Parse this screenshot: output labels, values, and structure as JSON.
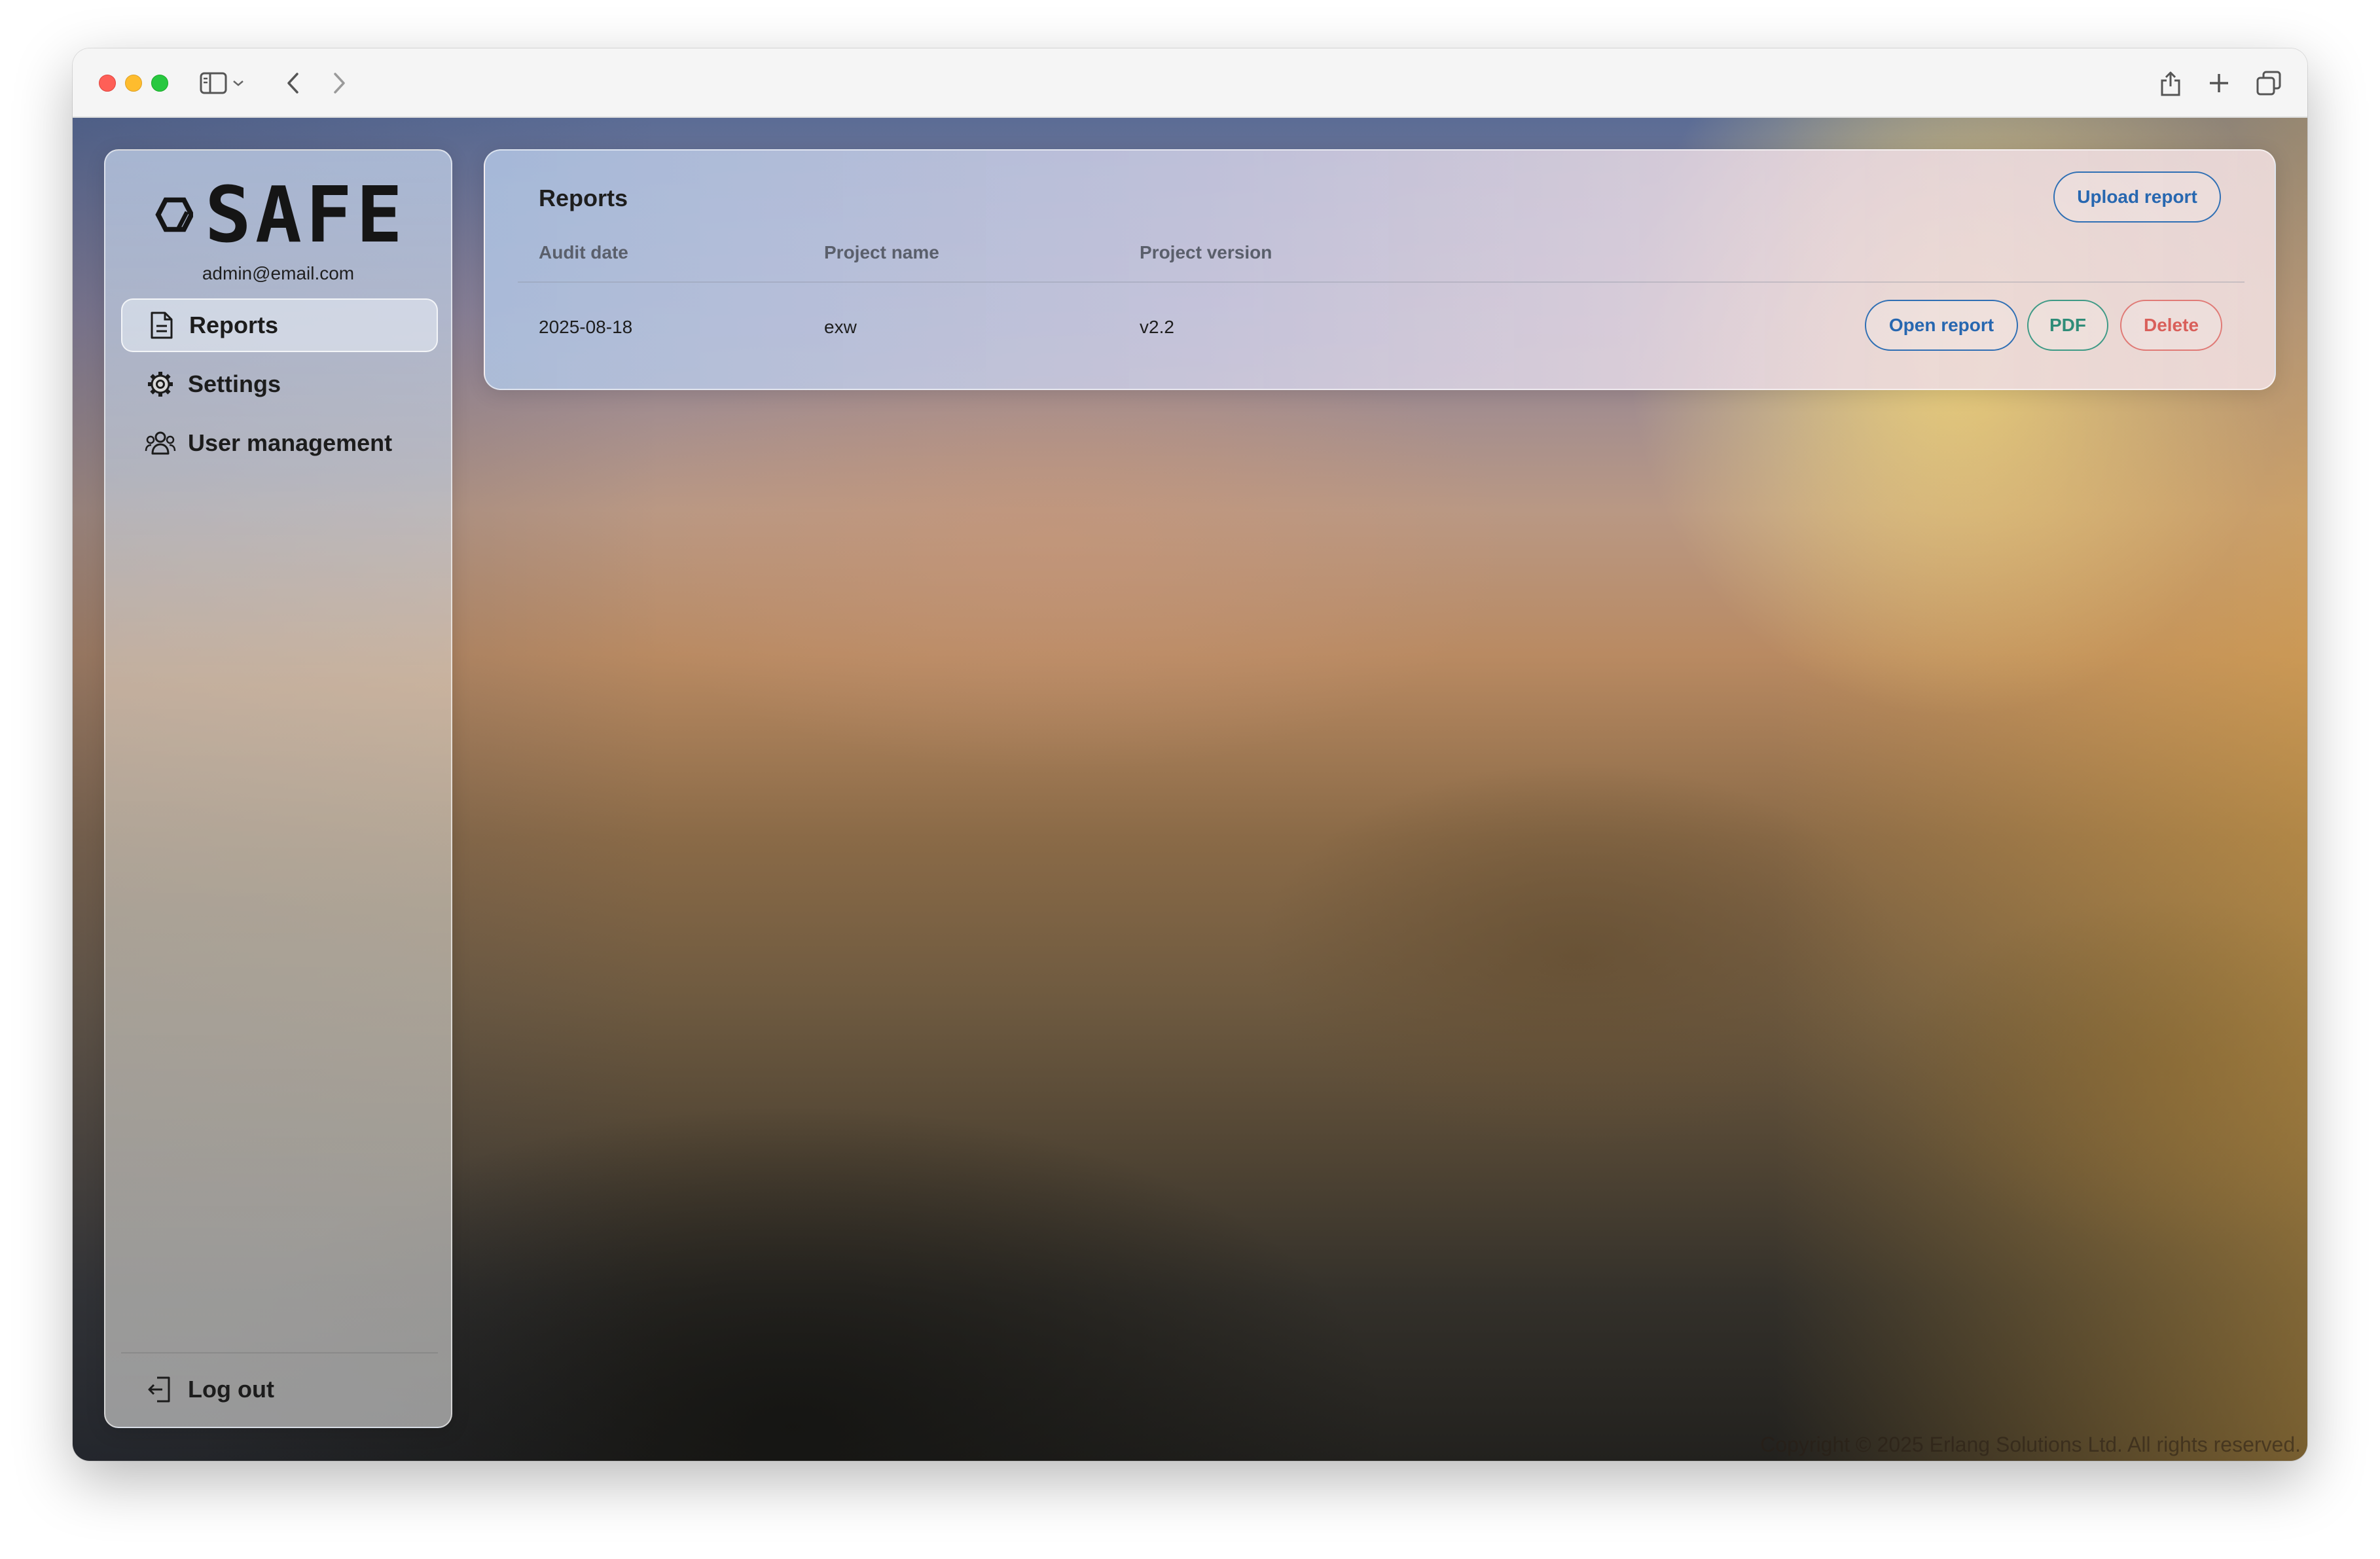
{
  "browser": {
    "icons": [
      "sidebar-toggle-icon",
      "chevron-down-icon",
      "back-icon",
      "forward-icon",
      "share-icon",
      "new-tab-icon",
      "tabs-overview-icon"
    ]
  },
  "sidebar": {
    "logo_text": "SAFE",
    "user_email": "admin@email.com",
    "items": [
      {
        "label": "Reports",
        "icon": "document-icon",
        "active": true
      },
      {
        "label": "Settings",
        "icon": "gear-icon",
        "active": false
      },
      {
        "label": "User management",
        "icon": "users-icon",
        "active": false
      }
    ],
    "logout_label": "Log out"
  },
  "reports": {
    "title": "Reports",
    "upload_label": "Upload report",
    "columns": [
      "Audit date",
      "Project name",
      "Project version"
    ],
    "rows": [
      {
        "audit_date": "2025-08-18",
        "project_name": "exw",
        "project_version": "v2.2",
        "actions": {
          "open": "Open report",
          "pdf": "PDF",
          "delete": "Delete"
        }
      }
    ]
  },
  "footer": {
    "copyright": "Copyright © 2025 Erlang Solutions Ltd. All rights reserved."
  },
  "colors": {
    "accent_blue": "#2767b0",
    "pdf_green": "#2f8c78",
    "delete_red": "#d95f5a"
  }
}
